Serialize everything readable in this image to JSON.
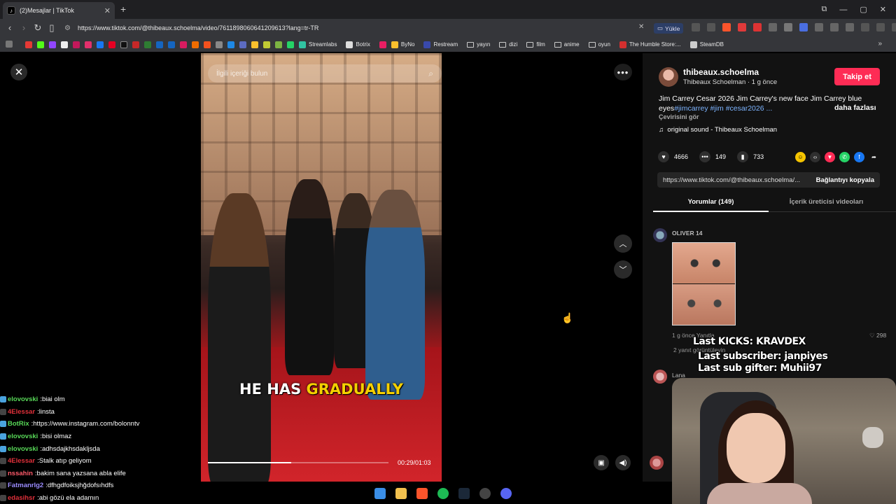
{
  "browser": {
    "tab_title": "(2)Mesajlar | TikTok",
    "tab_favicon": "tiktok-icon",
    "new_tab": "+",
    "url": "https://www.tiktok.com/@thibeaux.schoelma/video/7611898060641209613?lang=tr-TR",
    "upload_label": "Yükle",
    "bookmarks": [
      "Streamlabs",
      "Botrix",
      "ByNo",
      "Restream",
      "yayın",
      "dizi",
      "film",
      "anime",
      "oyun",
      "The Humble Store:...",
      "SteamDB"
    ]
  },
  "video": {
    "search_placeholder": "İlgili içeriği bulun",
    "caption_plain": "HE HAS ",
    "caption_highlight": "GRADUALLY",
    "time": "00:29/01:03",
    "progress_fraction": 0.46
  },
  "panel": {
    "username": "thibeaux.schoelma",
    "display_line": "Thibeaux Schoelman · 1 g önce",
    "follow_label": "Takip et",
    "description_plain": "Jim Carrey Cesar 2026 Jim Carrey's new face Jim Carrey blue eyes",
    "description_tags": "#jimcarrey #jim #cesar2026 ...",
    "more_label": "daha fazlası",
    "translate_label": "Çevirisini gör",
    "sound": "original sound - Thibeaux Schoelman",
    "likes": "4666",
    "comments": "149",
    "saves": "733",
    "copy_url": "https://www.tiktok.com/@thibeaux.schoelma/...",
    "copy_button": "Bağlantıyı kopyala",
    "tab_comments": "Yorumlar (149)",
    "tab_creator": "İçerik üreticisi videoları",
    "comment1_user": "OLIVER 14",
    "comment1_meta": "1 g önce    Yanıtla",
    "comment1_likes": "298",
    "comment1_replies": "2 yanıt görüntüleyin",
    "comment2_user": "Lana"
  },
  "overlay": {
    "kicks": "Last KICKS: KRAVDEX",
    "subscriber": "Last subscriber: janpiyes",
    "sub_gifter": "Last sub gifter: Muhii97"
  },
  "chat": [
    {
      "user": "elovovski",
      "color": "#58d858",
      "msg": "biai olm"
    },
    {
      "user": "4Elessar",
      "color": "#e0303a",
      "msg": "linsta"
    },
    {
      "user": "BotRix",
      "color": "#58d858",
      "msg": "https://www.instagram.com/bolonntv"
    },
    {
      "user": "elovovski",
      "color": "#58d858",
      "msg": "bisi olmaz"
    },
    {
      "user": "elovovski",
      "color": "#58d858",
      "msg": "adhsdajkhsdakljsda"
    },
    {
      "user": "4Elessar",
      "color": "#e0303a",
      "msg": "Stalk atıp geliyom"
    },
    {
      "user": "nssahin",
      "color": "#ff5a6a",
      "msg": "bakim sana yazsana abla elife"
    },
    {
      "user": "Fatmanrlg2",
      "color": "#9b8cff",
      "msg": "dfhgdfoiksjhğdofsıhdfs"
    },
    {
      "user": "edasihsr",
      "color": "#e0303a",
      "msg": "abi gözü ela adamın"
    }
  ],
  "colors": {
    "accent": "#fe2c55",
    "tag": "#7db4ff",
    "caption_highlight": "#f5d000"
  }
}
